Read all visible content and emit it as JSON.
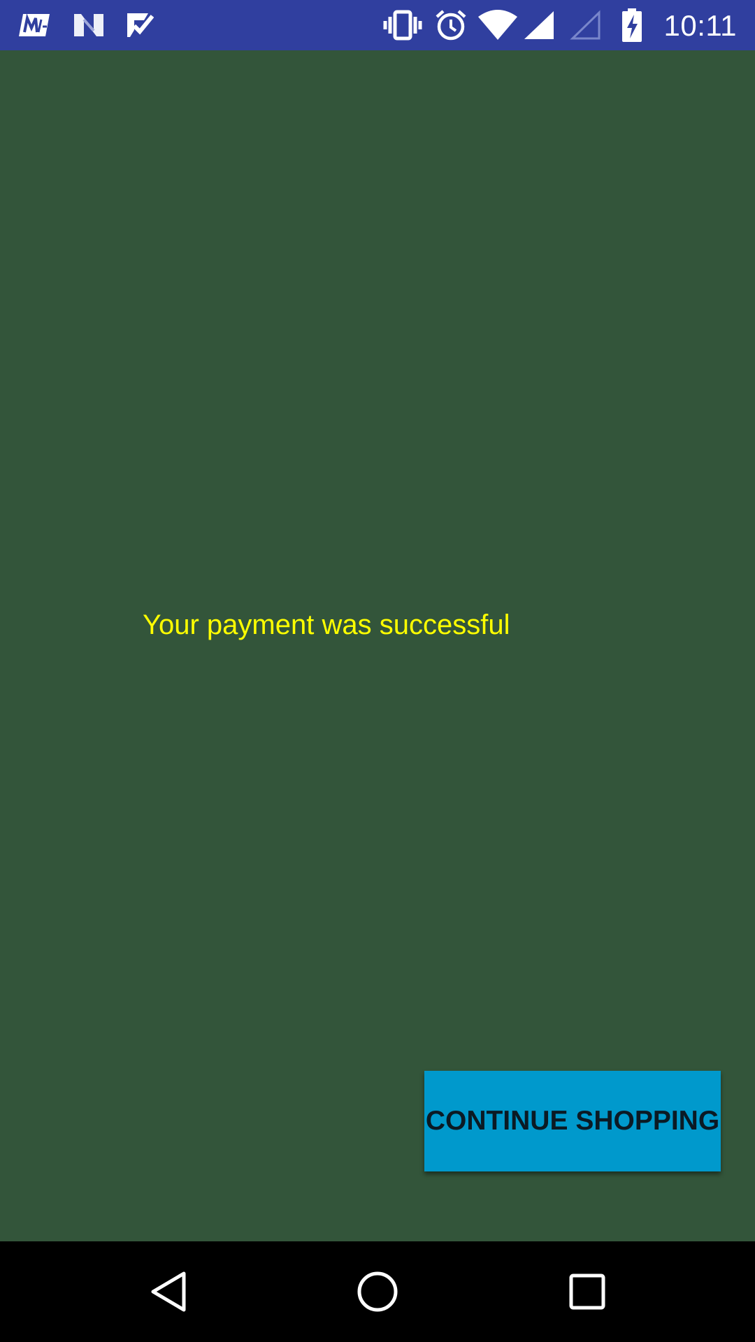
{
  "status_bar": {
    "time": "10:11",
    "background_color": "#303F9F",
    "left_icons": [
      "app-notification-icon",
      "n-notification-icon",
      "check-notification-icon"
    ],
    "right_icons": [
      "vibrate-icon",
      "alarm-icon",
      "wifi-icon",
      "cell-signal-icon",
      "cell-signal-empty-icon",
      "battery-charging-icon"
    ]
  },
  "main": {
    "background_color": "#33553A",
    "message": "Your payment was successful",
    "message_color": "#FFFF00",
    "continue_button": {
      "label": "CONTINUE SHOPPING",
      "color": "#0099CC"
    }
  },
  "nav_bar": {
    "buttons": [
      "back-icon",
      "home-icon",
      "recents-icon"
    ]
  }
}
